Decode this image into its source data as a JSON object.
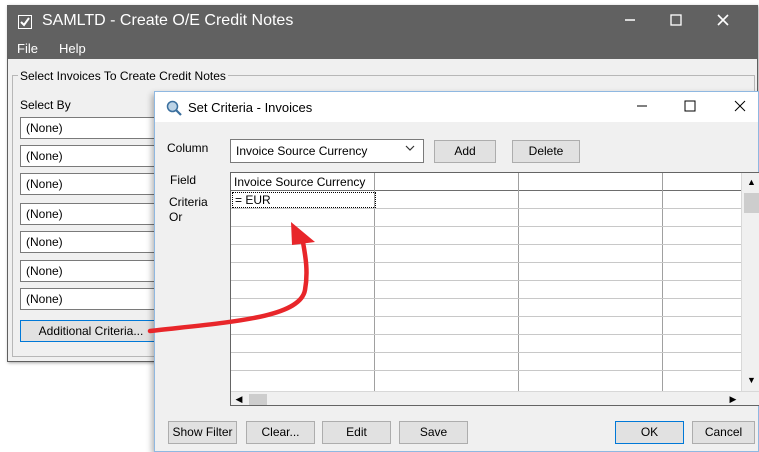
{
  "main_window": {
    "title": "SAMLTD - Create O/E Credit Notes",
    "menu": [
      "File",
      "Help"
    ],
    "group_label": "Select Invoices To Create Credit Notes",
    "select_by_label": "Select By",
    "select_fields": [
      "(None)",
      "(None)",
      "(None)",
      "(None)",
      "(None)",
      "(None)",
      "(None)"
    ],
    "additional_criteria_label": "Additional Criteria..."
  },
  "dialog": {
    "title": "Set Criteria - Invoices",
    "column_label": "Column",
    "column_value": "Invoice Source Currency",
    "add_label": "Add",
    "delete_label": "Delete",
    "field_label": "Field",
    "criteria_label": "Criteria",
    "or_label": "Or",
    "grid": {
      "header": [
        "Invoice Source Currency",
        "",
        "",
        ""
      ],
      "criteria_row": [
        "= EUR",
        "",
        "",
        ""
      ]
    },
    "buttons": {
      "show_filter": "Show Filter",
      "clear": "Clear...",
      "edit": "Edit",
      "save": "Save",
      "ok": "OK",
      "cancel": "Cancel"
    }
  },
  "icons": {
    "app": "checkbox-icon",
    "dialog": "search-icon",
    "annotation": "red-arrow"
  },
  "colors": {
    "titlebar": "#616161",
    "arrow": "#e8262a",
    "focus_border": "#0078d7"
  }
}
